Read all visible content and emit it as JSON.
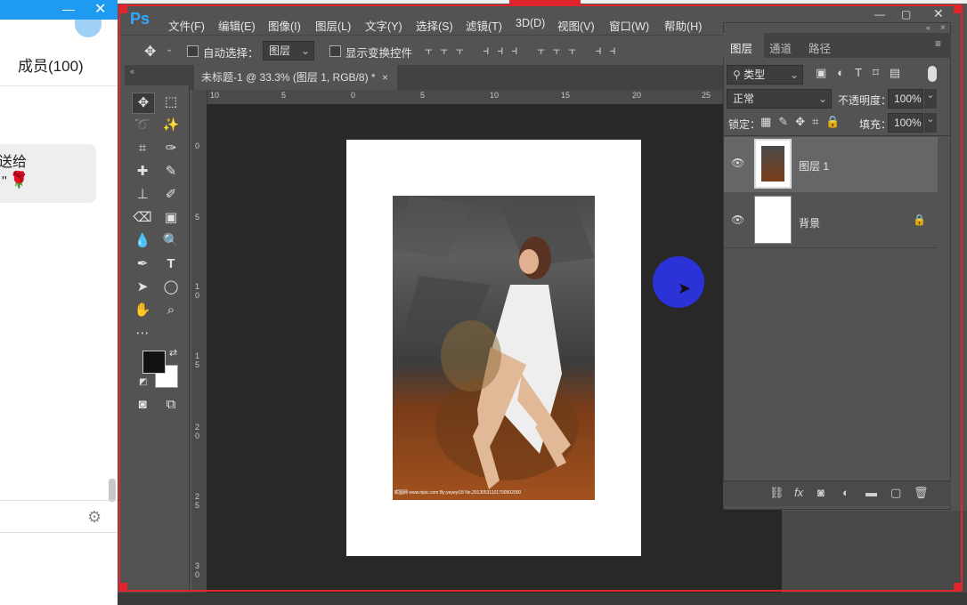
{
  "chat": {
    "members_label": "成员(100)",
    "message_fragment": "送给",
    "quote_mark": "\"",
    "emoji": "🌹"
  },
  "ps": {
    "logo": "Ps",
    "menus": [
      "文件(F)",
      "编辑(E)",
      "图像(I)",
      "图层(L)",
      "文字(Y)",
      "选择(S)",
      "滤镜(T)",
      "3D(D)",
      "视图(V)",
      "窗口(W)",
      "帮助(H)"
    ],
    "options": {
      "auto_select_label": "自动选择：",
      "auto_select_value": "图层",
      "show_transform_label": "显示变换控件"
    },
    "document_tab": "未标题-1 @ 33.3% (图层 1, RGB/8) *",
    "ruler_h_labels": [
      "10",
      "5",
      "0",
      "5",
      "10",
      "15",
      "20",
      "25"
    ],
    "ruler_v_labels": [
      "0",
      "5",
      "1 0",
      "1 5",
      "2 0",
      "2 5",
      "3 0"
    ],
    "photo_watermark": "昵图网 www.nipic.com    By:yeyeyi18 No.20130531101790902000"
  },
  "layers_panel": {
    "tabs": [
      "图层",
      "通道",
      "路径"
    ],
    "filter_label": "类型",
    "blend_mode": "正常",
    "opacity_label": "不透明度：",
    "opacity_value": "100%",
    "lock_label": "锁定：",
    "fill_label": "填充：",
    "fill_value": "100%",
    "layers": [
      {
        "name": "图层 1",
        "visible": true,
        "selected": true
      },
      {
        "name": "背景",
        "visible": true,
        "locked": true
      }
    ]
  },
  "colors": {
    "ps_bg": "#535353",
    "canvas_bg": "#282828",
    "frame_red": "#e0262c",
    "cursor_blob": "#2b33d8",
    "chat_accent": "#1e9bf0"
  }
}
